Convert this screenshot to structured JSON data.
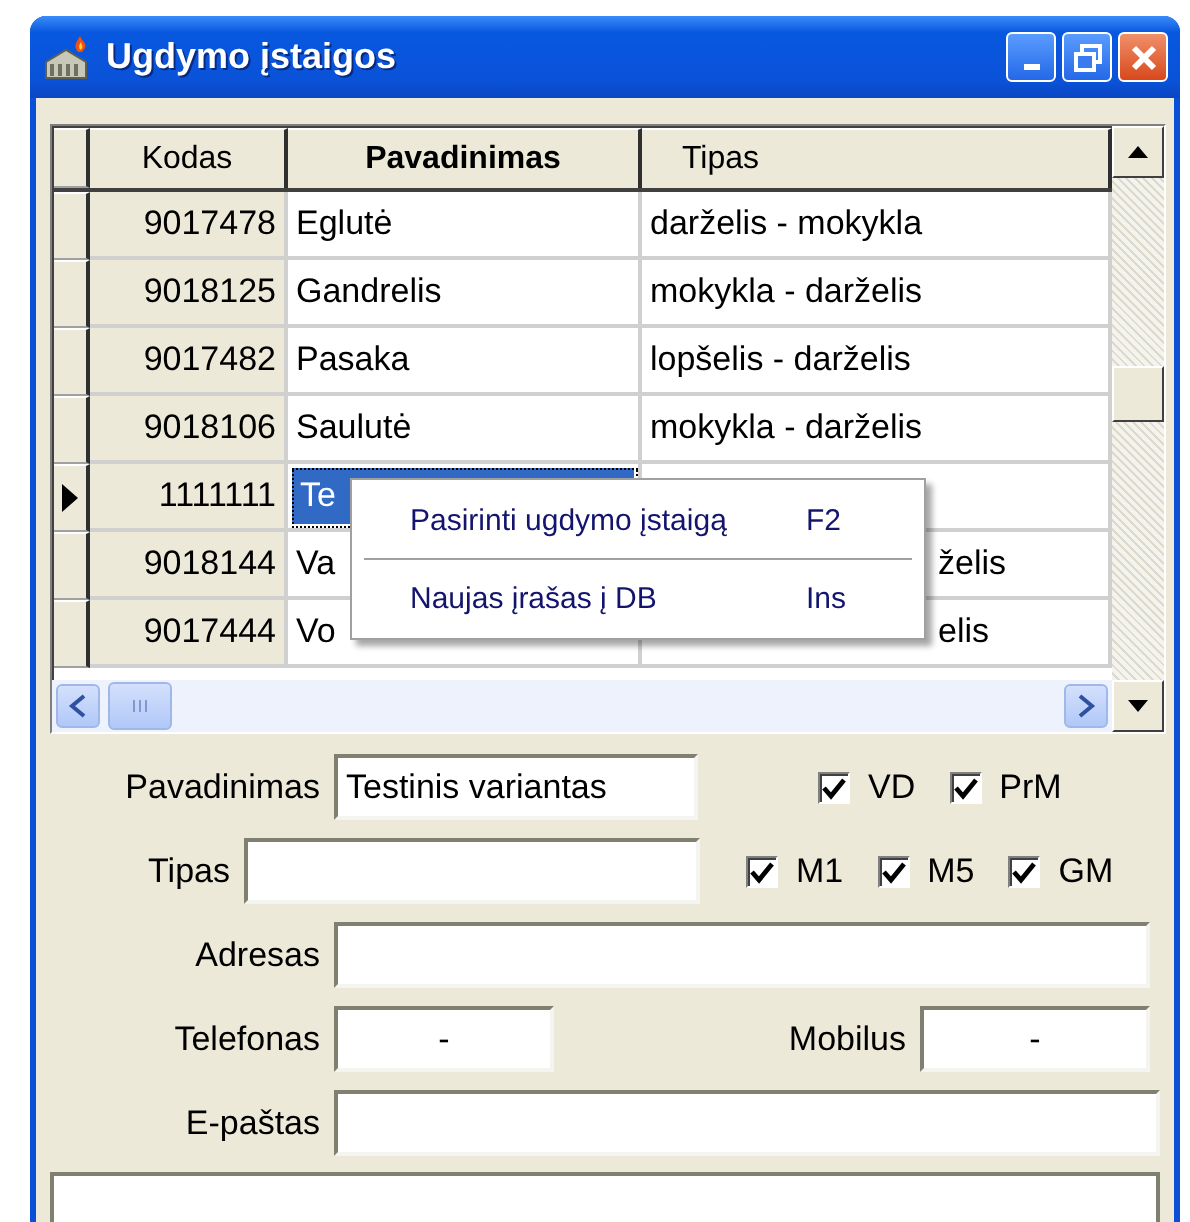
{
  "window": {
    "title": "Ugdymo įstaigos"
  },
  "grid": {
    "columns": [
      {
        "label": "Kodas",
        "highlighted": false
      },
      {
        "label": "Pavadinimas",
        "highlighted": true
      },
      {
        "label": "Tipas",
        "highlighted": false
      }
    ],
    "rows": [
      {
        "current": false,
        "cells": [
          {
            "text": "9017478",
            "selected": false
          },
          {
            "text": "Eglutė",
            "selected": false
          },
          {
            "text": "darželis - mokykla",
            "selected": false
          }
        ]
      },
      {
        "current": false,
        "cells": [
          {
            "text": "9018125",
            "selected": false
          },
          {
            "text": "Gandrelis",
            "selected": false
          },
          {
            "text": "mokykla - darželis",
            "selected": false
          }
        ]
      },
      {
        "current": false,
        "cells": [
          {
            "text": "9017482",
            "selected": false
          },
          {
            "text": "Pasaka",
            "selected": false
          },
          {
            "text": "lopšelis - darželis",
            "selected": false
          }
        ]
      },
      {
        "current": false,
        "cells": [
          {
            "text": "9018106",
            "selected": false
          },
          {
            "text": "Saulutė",
            "selected": false
          },
          {
            "text": "mokykla - darželis",
            "selected": false
          }
        ]
      },
      {
        "current": true,
        "cells": [
          {
            "text": "1111111",
            "selected": false
          },
          {
            "text": "Te",
            "selected": true
          },
          {
            "selected": false
          }
        ]
      },
      {
        "current": false,
        "cells": [
          {
            "text": "9018144",
            "selected": false
          },
          {
            "text": "Va",
            "selected": false
          },
          {
            "text": "želis",
            "selected": false
          }
        ]
      },
      {
        "current": false,
        "cells": [
          {
            "text": "9017444",
            "selected": false
          },
          {
            "text": "Vo",
            "selected": false
          },
          {
            "text": "elis",
            "selected": false
          }
        ]
      }
    ]
  },
  "context_menu": {
    "items": [
      {
        "label": "Pasirinti ugdymo įstaigą",
        "shortcut": "F2"
      },
      {
        "label": "Naujas įrašas į DB",
        "shortcut": "Ins"
      }
    ]
  },
  "form": {
    "name": {
      "label": "Pavadinimas",
      "value": "Testinis variantas"
    },
    "type": {
      "label": "Tipas"
    },
    "checks": [
      {
        "label": "VD",
        "checked": true
      },
      {
        "label": "PrM",
        "checked": true
      },
      {
        "label": "M1",
        "checked": true
      },
      {
        "label": "M5",
        "checked": true
      },
      {
        "label": "GM",
        "checked": true
      }
    ],
    "address": {
      "label": "Adresas"
    },
    "phone": {
      "label": "Telefonas",
      "value": "-"
    },
    "mobile": {
      "label": "Mobilus",
      "value": "-"
    },
    "email": {
      "label": "E-paštas"
    }
  }
}
